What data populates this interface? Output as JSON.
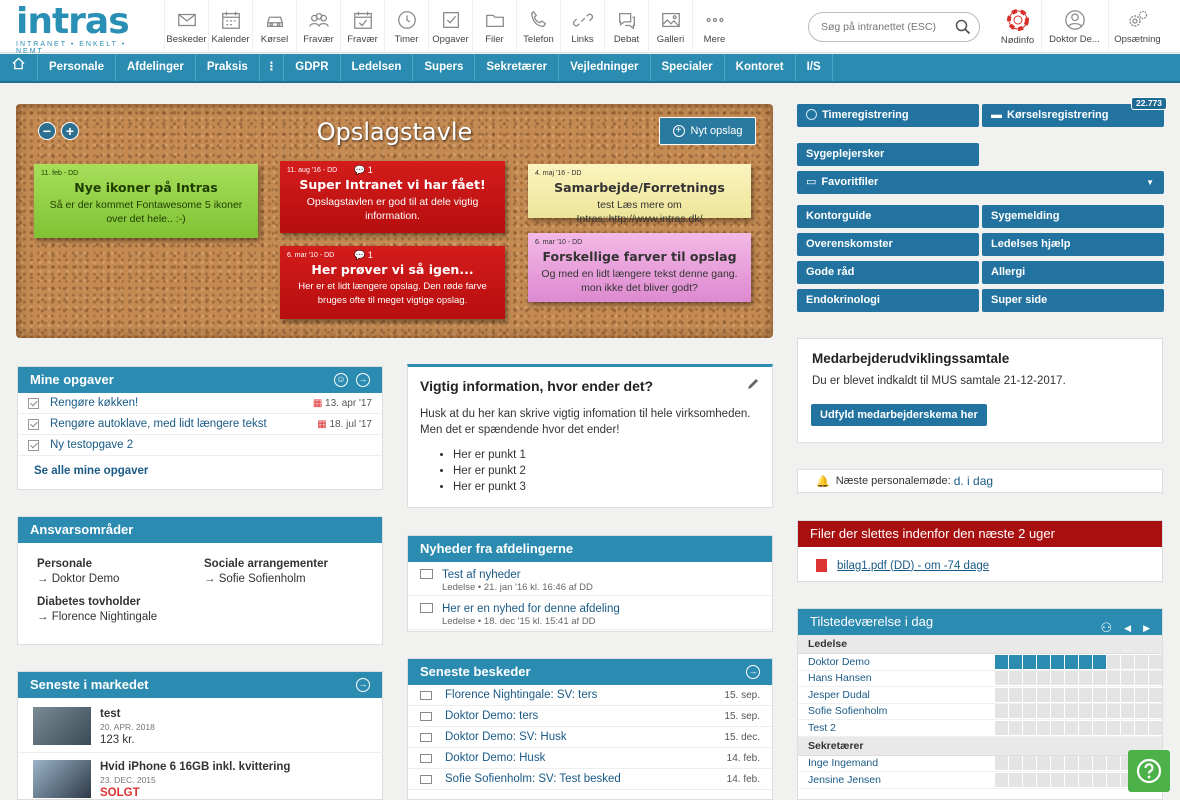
{
  "logo": {
    "word": "intras",
    "tagline": "INTRANET • ENKELT • NEMT"
  },
  "topnav": [
    {
      "label": "Beskeder",
      "icon": "envelope-icon"
    },
    {
      "label": "Kalender",
      "icon": "calendar-icon"
    },
    {
      "label": "Kørsel",
      "icon": "car-icon"
    },
    {
      "label": "Fravær",
      "icon": "users-icon"
    },
    {
      "label": "Fravær",
      "icon": "calendar-check-icon"
    },
    {
      "label": "Timer",
      "icon": "clock-icon"
    },
    {
      "label": "Opgaver",
      "icon": "checkbox-icon"
    },
    {
      "label": "Filer",
      "icon": "folder-icon"
    },
    {
      "label": "Telefon",
      "icon": "phone-icon"
    },
    {
      "label": "Links",
      "icon": "link-icon"
    },
    {
      "label": "Debat",
      "icon": "chat-icon"
    },
    {
      "label": "Galleri",
      "icon": "image-icon"
    },
    {
      "label": "Mere",
      "icon": "more-icon"
    }
  ],
  "search": {
    "placeholder": "Søg på intranettet (ESC)"
  },
  "right": {
    "emergency": "Nødinfo",
    "user": "Doktor De...",
    "settings": "Opsætning"
  },
  "menubar": [
    "Personale",
    "Afdelinger",
    "Praksis",
    "GDPR",
    "Ledelsen",
    "Supers",
    "Sekretærer",
    "Vejledninger",
    "Specialer",
    "Kontoret",
    "I/S"
  ],
  "board": {
    "title": "Opslagstavle",
    "new_button": "Nyt opslag",
    "notes": [
      {
        "date": "11. feb - DD",
        "comments": "",
        "title": "Nye ikoner på Intras",
        "text": "Så er der kommet Fontawesome 5 ikoner over det hele.. :-)"
      },
      {
        "date": "11. aug '16 - DD",
        "comments": "1",
        "title": "Super Intranet vi har fået!",
        "text": "Opslagstavlen er god til at dele vigtig information."
      },
      {
        "date": "4. maj '16 - DD",
        "comments": "",
        "title": "Samarbejde/Forretnings",
        "text": "test Læs mere om Intras::http://www.intras.dk/"
      },
      {
        "date": "6. mar '10 - DD",
        "comments": "1",
        "title": "Her prøver vi så igen...",
        "text": "Her er et lidt længere opslag. Den røde farve bruges ofte til meget vigtige opslag."
      },
      {
        "date": "6. mar '10 - DD",
        "comments": "",
        "title": "Forskellige farver til opslag",
        "text": "Og med en lidt længere tekst denne gang. mon ikke det bliver godt?"
      }
    ]
  },
  "tasks": {
    "title": "Mine opgaver",
    "items": [
      {
        "text": "Rengøre køkken!",
        "date": "13. apr '17"
      },
      {
        "text": "Rengøre autoklave, med lidt længere tekst",
        "date": "18. jul '17"
      },
      {
        "text": "Ny testopgave 2",
        "date": ""
      }
    ],
    "see_all": "Se alle mine opgaver"
  },
  "info": {
    "title": "Vigtig information, hvor ender det?",
    "body": "Husk at du her kan skrive vigtig infomation til hele virksomheden. Men det er spændende hvor det ender!",
    "bullets": [
      "Her er punkt 1",
      "Her er punkt 2",
      "Her er punkt 3"
    ]
  },
  "responsibility": {
    "title": "Ansvarsområder",
    "groups": [
      {
        "name": "Personale",
        "person": "→ Doktor Demo"
      },
      {
        "name": "Sociale arrangementer",
        "person": "→ Sofie Sofienholm"
      },
      {
        "name": "Diabetes tovholder",
        "person": "→ Florence Nightingale"
      }
    ]
  },
  "news": {
    "title": "Nyheder fra afdelingerne",
    "items": [
      {
        "title": "Test af nyheder",
        "meta": "Ledelse • 21. jan '16 kl. 16:46 af DD"
      },
      {
        "title": "Her er en nyhed for denne afdeling",
        "meta": "Ledelse • 18. dec '15 kl. 15:41 af DD"
      }
    ]
  },
  "market": {
    "title": "Seneste i markedet",
    "items": [
      {
        "title": "test",
        "date": "20. APR. 2018",
        "price": "123 kr.",
        "status": ""
      },
      {
        "title": "Hvid iPhone 6 16GB inkl. kvittering",
        "date": "23. DEC. 2015",
        "price": "",
        "status": "SOLGT"
      }
    ]
  },
  "messages": {
    "title": "Seneste beskeder",
    "items": [
      {
        "text": "Florence Nightingale: SV: ters",
        "date": "15. sep."
      },
      {
        "text": "Doktor Demo: ters",
        "date": "15. sep."
      },
      {
        "text": "Doktor Demo: SV: Husk",
        "date": "15. dec."
      },
      {
        "text": "Doktor Demo: Husk",
        "date": "14. feb."
      },
      {
        "text": "Sofie Sofienholm: SV: Test besked",
        "date": "14. feb."
      }
    ]
  },
  "quick": {
    "time": "Timeregistrering",
    "drive": "Kørselsregistrering",
    "drive_badge": "22.773",
    "nurses": "Sygeplejersker",
    "favorites": "Favoritfiler",
    "tiles": [
      "Kontorguide",
      "Sygemelding",
      "Overenskomster",
      "Ledelses hjælp",
      "Gode råd",
      "Allergi",
      "Endokrinologi",
      "Super side"
    ]
  },
  "mus": {
    "title": "Medarbejderudviklingssamtale",
    "text": "Du er blevet indkaldt til MUS samtale 21-12-2017.",
    "button": "Udfyld medarbejderskema her"
  },
  "meeting": {
    "label": "Næste personalemøde:",
    "value": "d. i dag"
  },
  "files": {
    "title": "Filer der slettes indenfor den næste 2 uger",
    "file": "bilag1.pdf (DD) - om -74 dage"
  },
  "presence": {
    "title": "Tilstedeværelse i dag",
    "groups": [
      {
        "name": "Ledelse",
        "people": [
          "Doktor Demo",
          "Hans Hansen",
          "Jesper Dudal",
          "Sofie Sofienholm",
          "Test 2"
        ]
      },
      {
        "name": "Sekretærer",
        "people": [
          "Inge Ingemand",
          "Jensine Jensen"
        ]
      }
    ]
  },
  "colors": {
    "primary": "#2b8bb0",
    "danger": "#b30f0f",
    "help": "#4db14a"
  }
}
